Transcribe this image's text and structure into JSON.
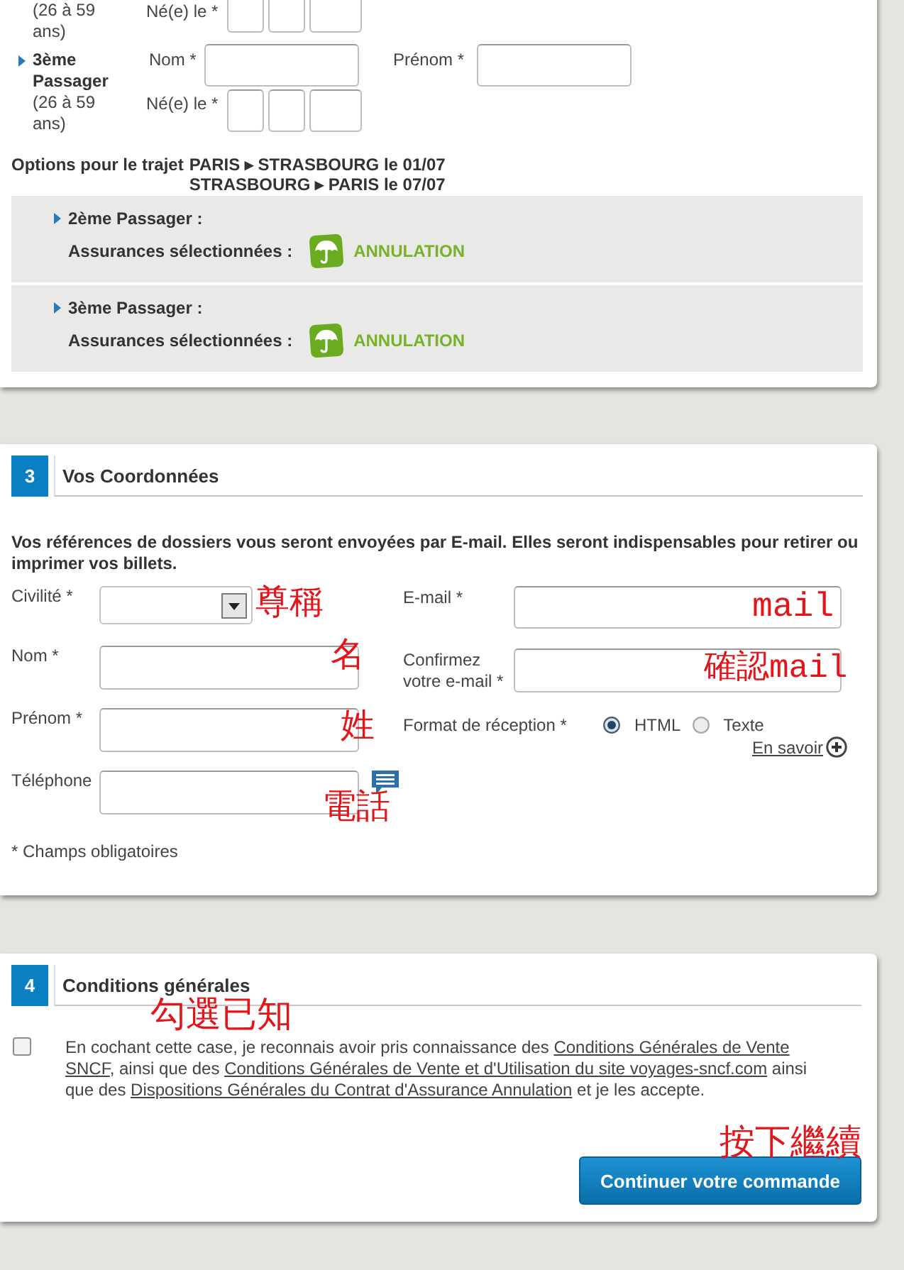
{
  "passengers": [
    {
      "kind": "partial",
      "age": "(26 à 59 ans)",
      "birth_label": "Né(e) le *"
    },
    {
      "kind": "full",
      "title": "3ème Passager",
      "age": "(26 à 59 ans)",
      "name_label": "Nom *",
      "first_name_label": "Prénom *",
      "birth_label": "Né(e) le *"
    }
  ],
  "trip_options": {
    "label": "Options pour le trajet",
    "routes": [
      "PARIS ▸ STRASBOURG le 01/07",
      "STRASBOURG ▸ PARIS le 07/07"
    ],
    "passengers": [
      {
        "title": "2ème Passager :",
        "insurance_label": "Assurances sélectionnées :",
        "insurance": "ANNULATION"
      },
      {
        "title": "3ème Passager :",
        "insurance_label": "Assurances sélectionnées :",
        "insurance": "ANNULATION"
      }
    ]
  },
  "contact": {
    "number": "3",
    "title": "Vos Coordonnées",
    "intro": "Vos références de dossiers vous seront envoyées par E-mail. Elles seront indispensables pour retirer ou imprimer vos billets.",
    "left_fields": [
      {
        "kind": "select",
        "label": "Civilité *",
        "annotation": "尊稱"
      },
      {
        "kind": "text",
        "label": "Nom *",
        "annotation": "名"
      },
      {
        "kind": "text",
        "label": "Prénom *",
        "annotation": "姓"
      },
      {
        "kind": "phone",
        "label": "Téléphone",
        "annotation": "電話"
      }
    ],
    "right_fields": [
      {
        "kind": "text",
        "label": "E-mail *",
        "annotation": "mail"
      },
      {
        "kind": "text",
        "label": "Confirmez votre e-mail *",
        "annotation": "確認mail"
      },
      {
        "kind": "radio",
        "label": "Format de réception *",
        "options": [
          {
            "label": "HTML",
            "selected": true
          },
          {
            "label": "Texte",
            "selected": false
          }
        ],
        "link": "En savoir"
      }
    ],
    "footnote": "* Champs obligatoires"
  },
  "terms": {
    "number": "4",
    "title": "Conditions générales",
    "annotation": "勾選已知",
    "checked": false,
    "text": [
      {
        "kind": "text",
        "text": "En cochant cette case, je reconnais avoir pris connaissance des "
      },
      {
        "kind": "link",
        "text": "Conditions Générales de Vente"
      },
      {
        "kind": "link",
        "text": "SNCF"
      },
      {
        "kind": "text",
        "text": ", ainsi que des "
      },
      {
        "kind": "link",
        "text": "Conditions Générales de Vente et d'Utilisation du site voyages-sncf.com"
      },
      {
        "kind": "text",
        "text": " ainsi que des "
      },
      {
        "kind": "link",
        "text": "Dispositions Générales du Contrat d'Assurance Annulation"
      },
      {
        "kind": "text",
        "text": " et je les accepte."
      }
    ]
  },
  "continue_button": {
    "label": "Continuer votre commande",
    "annotation": "按下繼續"
  }
}
